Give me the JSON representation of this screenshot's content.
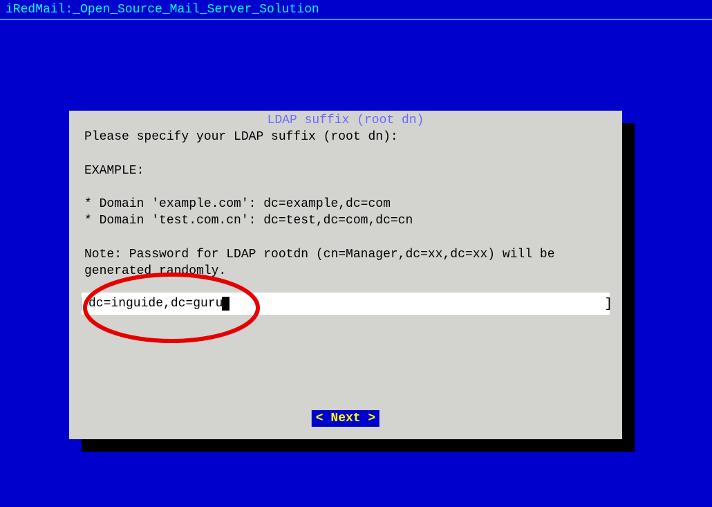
{
  "header": {
    "title": "iRedMail:_Open_Source_Mail_Server_Solution"
  },
  "dialog": {
    "title": "LDAP suffix (root dn)",
    "prompt": "Please specify your LDAP suffix (root dn):",
    "example_label": "EXAMPLE:",
    "example1": "* Domain 'example.com': dc=example,dc=com",
    "example2": "* Domain 'test.com.cn': dc=test,dc=com,dc=cn",
    "note": "Note: Password for LDAP rootdn (cn=Manager,dc=xx,dc=xx) will be\ngenerated randomly.",
    "input_value": "dc=inguide,dc=guru",
    "next_label": "< Next >"
  }
}
